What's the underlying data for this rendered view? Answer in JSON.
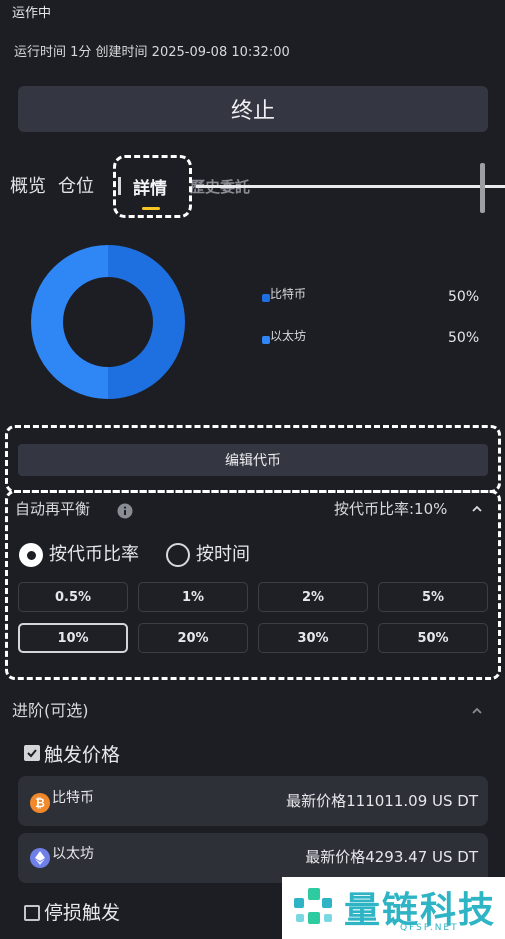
{
  "header": {
    "status": "运作中",
    "meta": "运行时间 1分 创建时间 2025-09-08 10:32:00"
  },
  "stop_label": "终止",
  "tabs": [
    "概览",
    "仓位",
    "詳情",
    "歷史委託"
  ],
  "allocation": {
    "items": [
      {
        "name": "比特币",
        "percent": "50%",
        "color": "#1e6fe0"
      },
      {
        "name": "以太坊",
        "percent": "50%",
        "color": "#2f87f5"
      }
    ]
  },
  "edit_coins_label": "编辑代币",
  "rebalance": {
    "title": "自动再平衡",
    "status": "按代币比率:10%",
    "options": [
      "按代币比率",
      "按时间"
    ],
    "thresholds_row1": [
      "0.5%",
      "1%",
      "2%",
      "5%"
    ],
    "thresholds_row2": [
      "10%",
      "20%",
      "30%",
      "50%"
    ]
  },
  "advanced": {
    "title": "进阶(可选)",
    "trigger_label": "触发价格",
    "coins": [
      {
        "name": "比特币",
        "price": "最新价格111011.09 US DT",
        "icon": "bitcoin-icon",
        "color": "#f0892c"
      },
      {
        "name": "以太坊",
        "price": "最新价格4293.47 US DT",
        "icon": "ethereum-icon",
        "color": "#6f7fe8"
      }
    ],
    "stoploss_label": "停损触发"
  },
  "watermark": {
    "text": "量链科技",
    "sub": "QFSP.NET"
  }
}
